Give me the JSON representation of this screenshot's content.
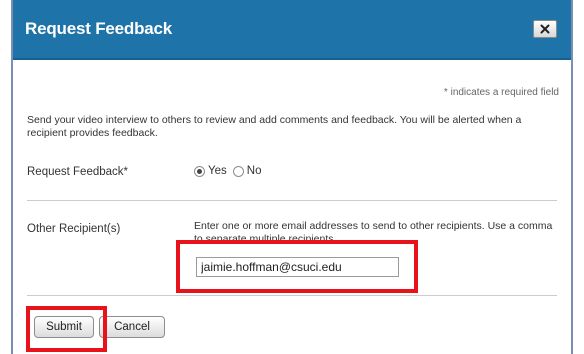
{
  "dialog": {
    "title": "Request Feedback",
    "close_icon": "close-x-icon",
    "required_note": "* indicates a required field",
    "intro": "Send your video interview to others to review and add comments and feedback. You will be alerted when a recipient provides feedback."
  },
  "request_feedback": {
    "label": "Request Feedback*",
    "options": [
      "Yes",
      "No"
    ],
    "selected": "Yes"
  },
  "recipients": {
    "label": "Other Recipient(s)",
    "help": "Enter one or more email addresses to send to other recipients. Use a comma to separate multiple recipients.",
    "value": "jaimie.hoffman@csuci.edu"
  },
  "buttons": {
    "submit": "Submit",
    "cancel": "Cancel"
  },
  "colors": {
    "title_bar": "#1e73a8",
    "highlight": "#e8121b"
  }
}
